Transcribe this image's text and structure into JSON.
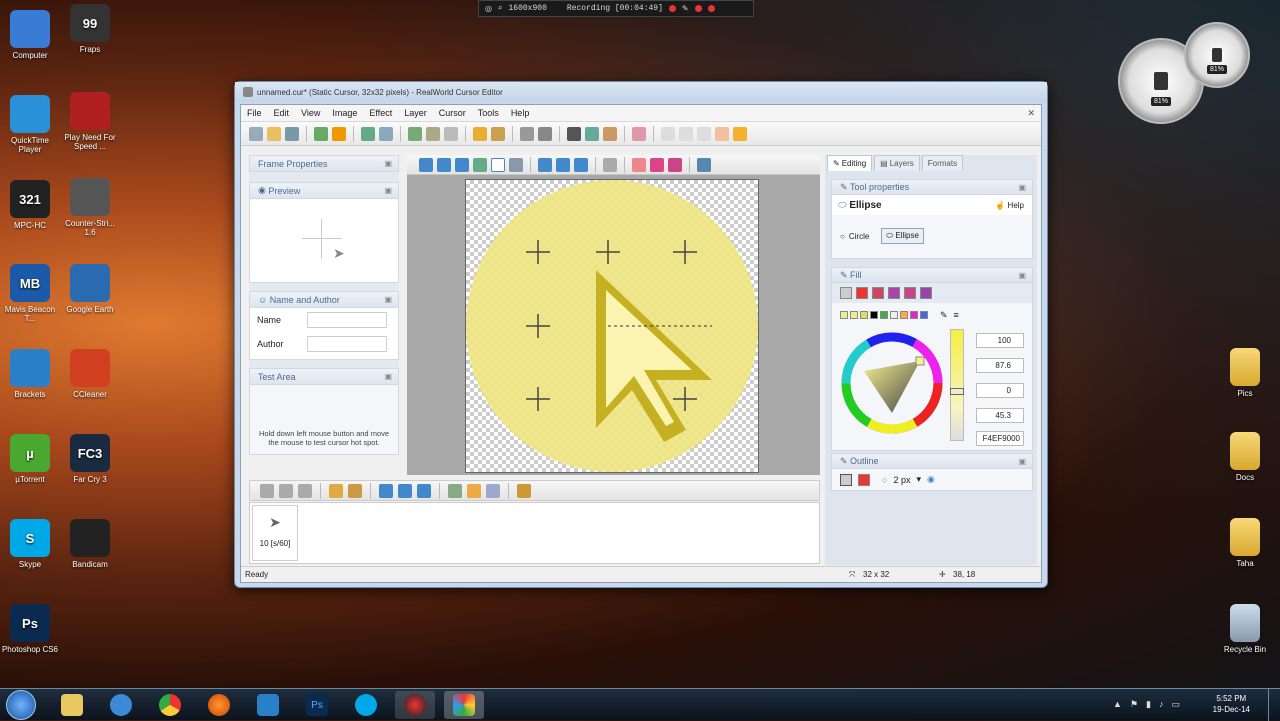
{
  "recording": {
    "resolution": "1600x900",
    "status": "Recording [00:04:49]"
  },
  "gadget": {
    "cpu": "81%",
    "ram": "81%"
  },
  "desktop": {
    "left": [
      {
        "name": "computer",
        "label": "Computer",
        "color": "#3a7bd5"
      },
      {
        "name": "fraps",
        "label": "Fraps",
        "color": "#333",
        "text": "99"
      },
      {
        "name": "quicktime",
        "label": "QuickTime Player",
        "color": "#2a90d8"
      },
      {
        "name": "need-for-speed",
        "label": "Play Need For Speed ...",
        "color": "#b02020"
      },
      {
        "name": "mpc-hc",
        "label": "MPC-HC",
        "color": "#222",
        "text": "321"
      },
      {
        "name": "counter-strike",
        "label": "Counter-Stri... 1.6",
        "color": "#555"
      },
      {
        "name": "mavis",
        "label": "Mavis Beacon T...",
        "color": "#1a5aa8",
        "text": "MB"
      },
      {
        "name": "google-earth",
        "label": "Google Earth",
        "color": "#2a6ab0"
      },
      {
        "name": "brackets",
        "label": "Brackets",
        "color": "#2a80c8"
      },
      {
        "name": "ccleaner",
        "label": "CCleaner",
        "color": "#d04020"
      },
      {
        "name": "utorrent",
        "label": "µTorrent",
        "color": "#4aa830",
        "text": "µ"
      },
      {
        "name": "far-cry",
        "label": "Far Cry 3",
        "color": "#1a2a40",
        "text": "FC3"
      },
      {
        "name": "skype",
        "label": "Skype",
        "color": "#00a8e8",
        "text": "S"
      },
      {
        "name": "bandicam",
        "label": "Bandicam",
        "color": "#222"
      },
      {
        "name": "photoshop",
        "label": "Photoshop CS6",
        "color": "#0a2a50",
        "text": "Ps"
      }
    ],
    "right": [
      {
        "name": "pics",
        "label": "Pics"
      },
      {
        "name": "docs",
        "label": "Docs"
      },
      {
        "name": "taha",
        "label": "Taha"
      },
      {
        "name": "recycle",
        "label": "Recycle Bin"
      }
    ]
  },
  "window": {
    "title": "unnamed.cur* (Static Cursor, 32x32 pixels) - RealWorld Cursor Editor",
    "menu": [
      "File",
      "Edit",
      "View",
      "Image",
      "Effect",
      "Layer",
      "Cursor",
      "Tools",
      "Help"
    ]
  },
  "left": {
    "frame_properties": "Frame Properties",
    "preview": "Preview",
    "name_author": "Name and Author",
    "name_label": "Name",
    "author_label": "Author",
    "test_area": "Test Area",
    "test_hint": "Hold down left mouse button and move the mouse to test cursor hot spot."
  },
  "frames": {
    "frame_label": "10 [s/60]"
  },
  "right": {
    "tabs": [
      "Editing",
      "Layers",
      "Formats"
    ],
    "tool_properties": "Tool properties",
    "tool_name": "Ellipse",
    "help": "Help",
    "circle": "Circle",
    "ellipse": "Ellipse",
    "fill": "Fill",
    "outline": "Outline",
    "outline_width": "2 px",
    "values": [
      "100",
      "87.6",
      "0",
      "45.3"
    ],
    "hex": "F4EF9000"
  },
  "status": {
    "ready": "Ready",
    "size": "32 x 32",
    "pos": "38, 18"
  },
  "taskbar": {
    "time": "5:52 PM",
    "date": "19-Dec-14"
  }
}
